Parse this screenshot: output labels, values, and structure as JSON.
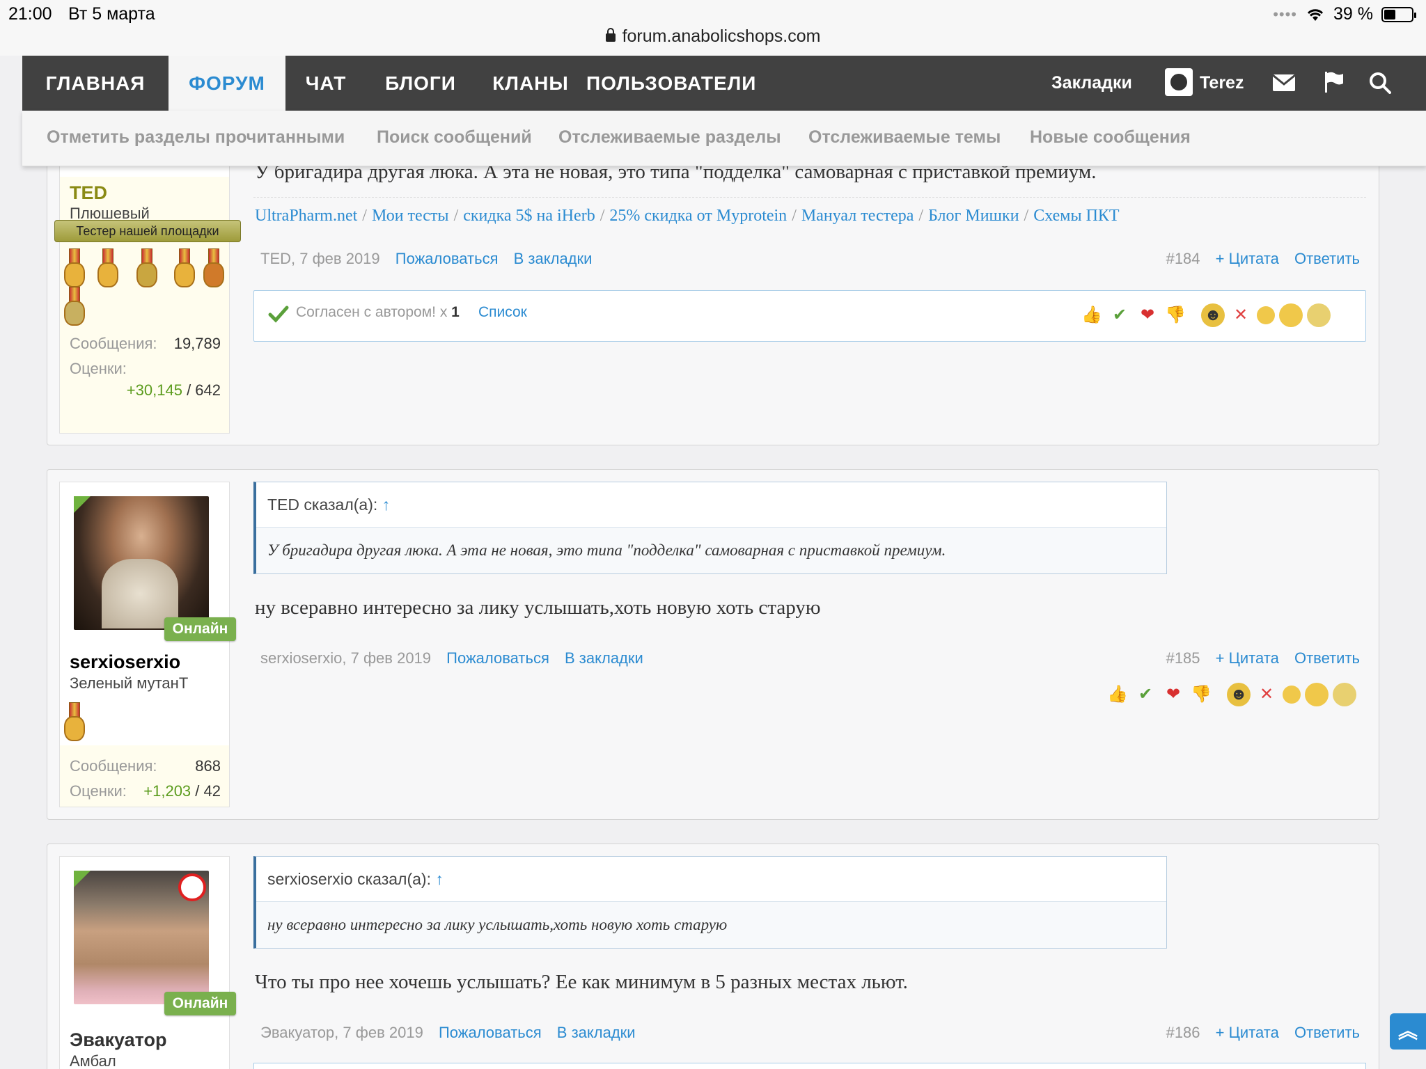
{
  "status_bar": {
    "time": "21:00",
    "date": "Вт 5 марта",
    "battery": "39 %"
  },
  "browser": {
    "url": "forum.anabolicshops.com"
  },
  "nav": {
    "tabs": [
      "ГЛАВНАЯ",
      "ФОРУМ",
      "ЧАТ",
      "БЛОГИ",
      "КЛАНЫ",
      "ПОЛЬЗОВАТЕЛИ"
    ],
    "active_tab": "ФОРУМ",
    "bookmarks": "Закладки",
    "username": "Terez"
  },
  "subnav": [
    "Отметить разделы прочитанными",
    "Поиск сообщений",
    "Отслеживаемые разделы",
    "Отслеживаемые темы",
    "Новые сообщения"
  ],
  "posts": [
    {
      "author": "TED",
      "user_title": "Плюшевый",
      "banner": "Тестер нашей площадки",
      "messages_label": "Сообщения:",
      "messages": "19,789",
      "ratings_label": "Оценки:",
      "ratings_pos": "+30,145",
      "ratings_total": "/ 642",
      "text": "У бригадира другая люка. А эта не новая, это типа \"подделка\" самоварная с приставкой премиум.",
      "signature": [
        "UltraPharm.net",
        "Мои тесты",
        "скидка 5$ на iHerb",
        "25% скидка от Myprotein",
        "Мануал тестера",
        "Блог Мишки",
        "Схемы ПКТ"
      ],
      "byline": "TED, 7 фев 2019",
      "report": "Пожаловаться",
      "bookmark": "В закладки",
      "number": "#184",
      "quote": "+ Цитата",
      "reply": "Ответить",
      "likes_text": "Согласен с автором! x",
      "likes_count": "1",
      "likes_list": "Список"
    },
    {
      "author": "serxioserxio",
      "user_title": "Зеленый мутанТ",
      "online": "Онлайн",
      "messages_label": "Сообщения:",
      "messages": "868",
      "ratings_label": "Оценки:",
      "ratings_pos": "+1,203",
      "ratings_total": "/ 42",
      "quote_author": "TED сказал(а):",
      "quote_arrow": "↑",
      "quote_text": "У бригадира другая люка. А эта не новая, это типа \"подделка\" самоварная с приставкой премиум.",
      "text": "ну всеравно интересно за лику услышать,хоть новую хоть старую",
      "byline": "serxioserxio, 7 фев 2019",
      "report": "Пожаловаться",
      "bookmark": "В закладки",
      "number": "#185",
      "quote": "+ Цитата",
      "reply": "Ответить"
    },
    {
      "author": "Эвакуатор",
      "user_title": "Амбал",
      "online": "Онлайн",
      "quote_author": "serxioserxio сказал(а):",
      "quote_arrow": "↑",
      "quote_text": "ну всеравно интересно за лику услышать,хоть новую хоть старую",
      "text": "Что ты про нее хочешь услышать? Ее как минимум в 5 разных местах льют.",
      "byline": "Эвакуатор, 7 фев 2019",
      "report": "Пожаловаться",
      "bookmark": "В закладки",
      "number": "#186",
      "quote": "+ Цитата",
      "reply": "Ответить"
    }
  ],
  "colors": {
    "nav_bg": "#414141",
    "link": "#2b8bd1",
    "positive": "#5a9b1c",
    "online": "#7ab04e",
    "author_ted": "#8a8a14"
  }
}
